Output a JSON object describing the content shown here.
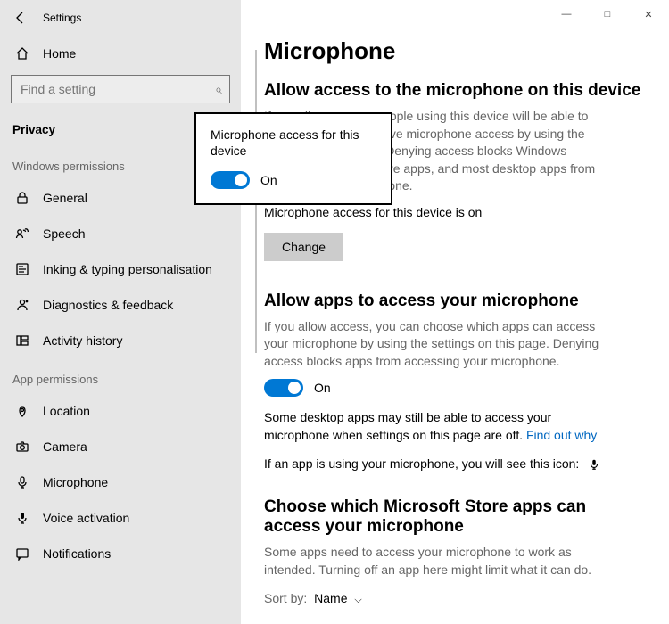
{
  "app": {
    "title": "Settings"
  },
  "window_controls": {
    "minimize": "—",
    "maximize": "□",
    "close": "✕"
  },
  "sidebar": {
    "home": "Home",
    "search_placeholder": "Find a setting",
    "heading": "Privacy",
    "groups": {
      "windows_permissions": {
        "label": "Windows permissions",
        "items": [
          "General",
          "Speech",
          "Inking & typing personalisation",
          "Diagnostics & feedback",
          "Activity history"
        ]
      },
      "app_permissions": {
        "label": "App permissions",
        "items": [
          "Location",
          "Camera",
          "Microphone",
          "Voice activation",
          "Notifications"
        ]
      }
    }
  },
  "main": {
    "title": "Microphone",
    "section1": {
      "title": "Allow access to the microphone on this device",
      "body": "If you allow access, people using this device will be able to choose if their apps have microphone access by using the settings on this page. Denying access blocks Windows features, Microsoft Store apps, and most desktop apps from accessing the microphone.",
      "status": "Microphone access for this device is on",
      "change": "Change"
    },
    "section2": {
      "title": "Allow apps to access your microphone",
      "body": "If you allow access, you can choose which apps can access your microphone by using the settings on this page. Denying access blocks apps from accessing your microphone.",
      "toggle_state": "On",
      "desktop_note_pre": "Some desktop apps may still be able to access your microphone when settings on this page are off. ",
      "desktop_note_link": "Find out why",
      "icon_note": "If an app is using your microphone, you will see this icon:"
    },
    "section3": {
      "title": "Choose which Microsoft Store apps can access your microphone",
      "body": "Some apps need to access your microphone to work as intended. Turning off an app here might limit what it can do.",
      "sort_label": "Sort by:",
      "sort_value": "Name"
    }
  },
  "popup": {
    "title": "Microphone access for this device",
    "toggle_state": "On"
  }
}
